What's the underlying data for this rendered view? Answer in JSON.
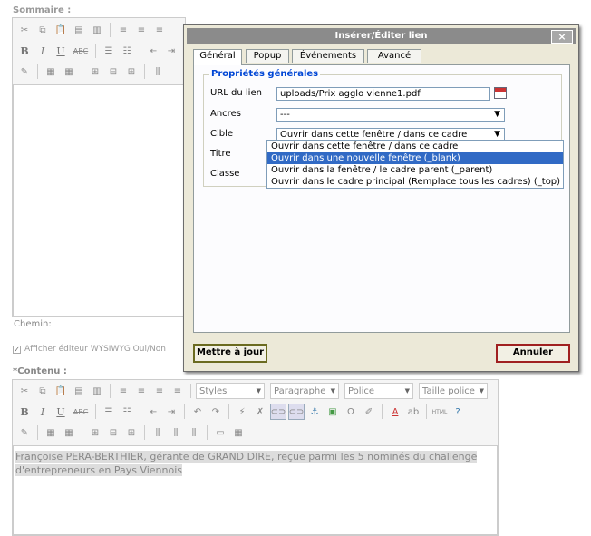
{
  "top_editor": {
    "label": "Sommaire :",
    "path_label": "Chemin:"
  },
  "wysiwyg_toggle": {
    "label": "Afficher éditeur WYSIWYG Oui/Non",
    "checked": true
  },
  "content_editor": {
    "label": "*Contenu :",
    "styles": "Styles",
    "format": "Paragraphe",
    "font": "Police",
    "size": "Taille police",
    "text": "Françoise PERA-BERTHIER, gérante de GRAND DIRE, reçue parmi les 5 nominés du challenge d'entrepreneurs en Pays Viennois"
  },
  "dialog": {
    "title": "Insérer/Éditer lien",
    "close": "×",
    "tabs": [
      "Général",
      "Popup",
      "Événements",
      "Avancé"
    ],
    "legend": "Propriétés générales",
    "fields": {
      "url_label": "URL du lien",
      "url_value": "uploads/Prix agglo vienne1.pdf",
      "anchors_label": "Ancres",
      "anchors_value": "---",
      "target_label": "Cible",
      "target_value": "Ouvrir dans cette fenêtre / dans ce cadre",
      "title_label": "Titre",
      "class_label": "Classe"
    },
    "target_options": [
      "Ouvrir dans cette fenêtre / dans ce cadre",
      "Ouvrir dans une nouvelle fenêtre (_blank)",
      "Ouvrir dans la fenêtre / le cadre parent (_parent)",
      "Ouvrir dans le cadre principal (Remplace tous les cadres) (_top)"
    ],
    "highlighted_option": 1,
    "update_button": "Mettre à jour",
    "cancel_button": "Annuler"
  }
}
